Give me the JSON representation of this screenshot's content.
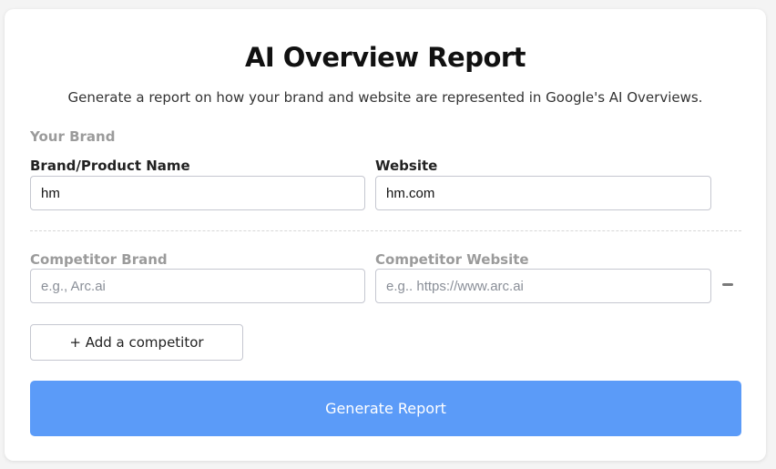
{
  "header": {
    "title": "AI Overview Report",
    "subtitle": "Generate a report on how your brand and website are represented in Google's AI Overviews."
  },
  "brand_section": {
    "heading": "Your Brand",
    "brand_label": "Brand/Product Name",
    "brand_value": "hm",
    "website_label": "Website",
    "website_value": "hm.com"
  },
  "competitors": [
    {
      "brand_label": "Competitor Brand",
      "brand_placeholder": "e.g., Arc.ai",
      "website_label": "Competitor Website",
      "website_placeholder": "e.g.. https://www.arc.ai",
      "remove_icon": "minus-icon"
    }
  ],
  "actions": {
    "add_competitor_label": "+ Add a competitor",
    "generate_label": "Generate Report"
  },
  "colors": {
    "primary_button": "#5b9bf8",
    "muted_label": "#9b9b9b"
  }
}
